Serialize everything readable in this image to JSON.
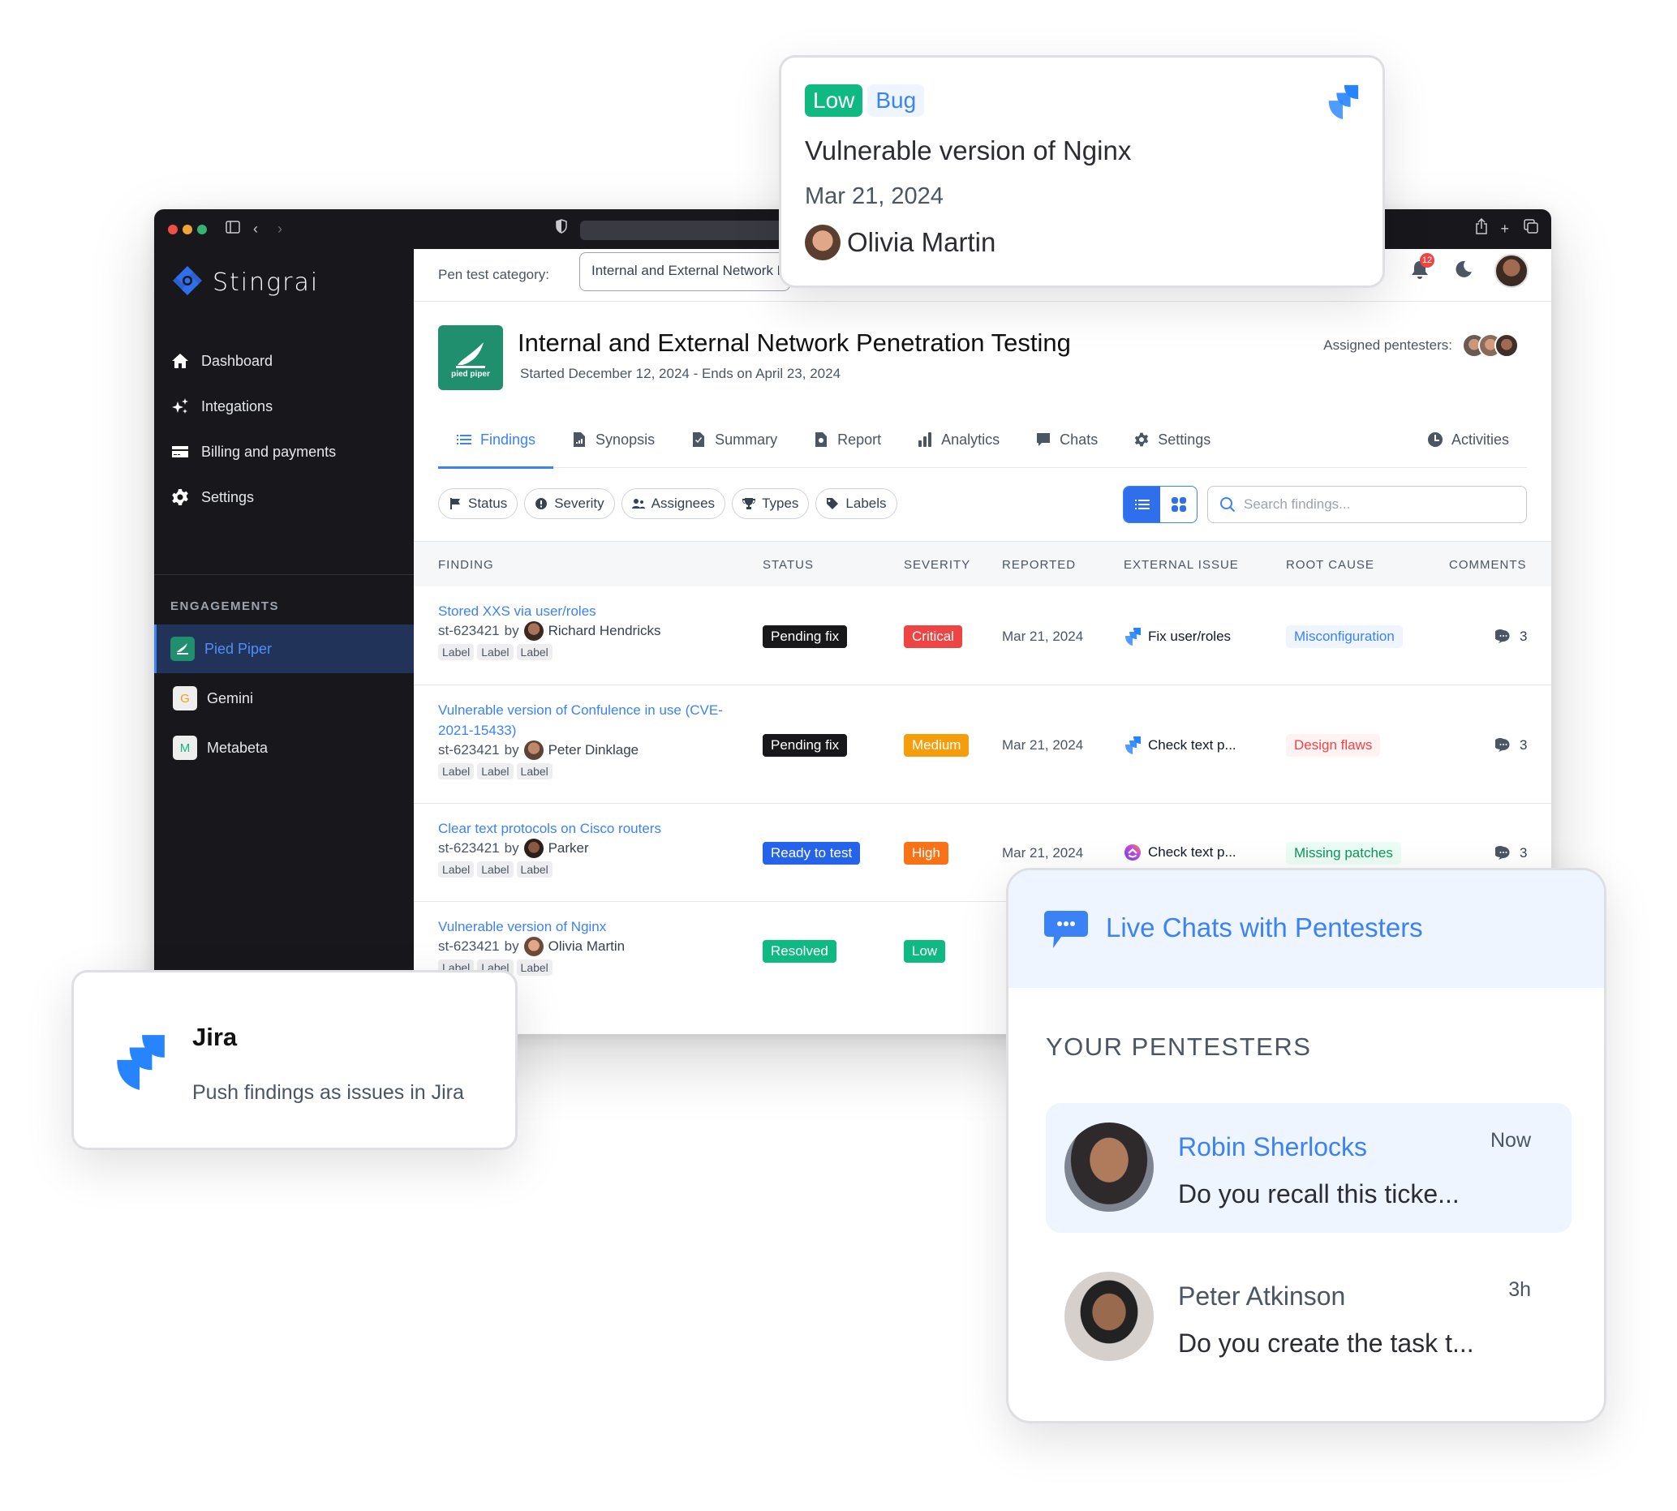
{
  "browser": {
    "controls": [
      "close",
      "minimize",
      "maximize"
    ],
    "toolbar_icons_left": [
      "sidebar-toggle-icon",
      "back-icon",
      "forward-icon"
    ],
    "toolbar_icons_right": [
      "share-icon",
      "new-tab-icon",
      "tabs-overview-icon"
    ]
  },
  "sidebar": {
    "brand": "Stingrai",
    "nav": [
      {
        "label": "Dashboard",
        "icon": "home-icon"
      },
      {
        "label": "Integations",
        "icon": "sparkles-icon"
      },
      {
        "label": "Billing and payments",
        "icon": "credit-card-icon"
      },
      {
        "label": "Settings",
        "icon": "gear-icon"
      }
    ],
    "section_label": "ENGAGEMENTS",
    "engagements": [
      {
        "label": "Pied Piper",
        "logo": "pied-piper",
        "active": true
      },
      {
        "label": "Gemini",
        "logo": "G",
        "active": false
      },
      {
        "label": "Metabeta",
        "logo": "M",
        "active": false
      }
    ]
  },
  "topbar": {
    "category_label": "Pen test category:",
    "category_value": "Internal and External Network Penetration Testing",
    "notifications_count": "12"
  },
  "project": {
    "logo_text": "pied piper",
    "title": "Internal and External Network Penetration Testing",
    "dates": "Started December 12, 2024 - Ends on April 23, 2024",
    "assigned_label": "Assigned pentesters:"
  },
  "tabs": [
    {
      "label": "Findings",
      "icon": "list-icon",
      "active": true
    },
    {
      "label": "Synopsis",
      "icon": "chart-file-icon"
    },
    {
      "label": "Summary",
      "icon": "check-file-icon"
    },
    {
      "label": "Report",
      "icon": "search-file-icon"
    },
    {
      "label": "Analytics",
      "icon": "bar-chart-icon"
    },
    {
      "label": "Chats",
      "icon": "chat-icon"
    },
    {
      "label": "Settings",
      "icon": "gear-icon"
    },
    {
      "label": "Activities",
      "icon": "clock-icon"
    }
  ],
  "filters": [
    {
      "label": "Status",
      "icon": "flag-icon"
    },
    {
      "label": "Severity",
      "icon": "exclamation-icon"
    },
    {
      "label": "Assignees",
      "icon": "users-icon"
    },
    {
      "label": "Types",
      "icon": "trophy-icon"
    },
    {
      "label": "Labels",
      "icon": "tag-icon"
    }
  ],
  "search": {
    "placeholder": "Search findings..."
  },
  "table": {
    "columns": [
      "FINDING",
      "STATUS",
      "SEVERITY",
      "REPORTED",
      "EXTERNAL ISSUE",
      "ROOT CAUSE",
      "COMMENTS"
    ],
    "rows": [
      {
        "title": "Stored XXS via user/roles",
        "id": "st-623421",
        "by": "by",
        "reporter": "Richard Hendricks",
        "labels": [
          "Label",
          "Label",
          "Label"
        ],
        "status": "Pending fix",
        "status_color": "#18181b",
        "severity": "Critical",
        "severity_color": "#ef4444",
        "reported": "Mar 21, 2024",
        "external_issue": "Fix user/roles",
        "external_icon": "jira",
        "root_cause": "Misconfiguration",
        "rc_bg": "#eef5ff",
        "rc_fg": "#3b82f6",
        "comments": "3"
      },
      {
        "title": "Vulnerable version of Confulence in use (CVE-2021-15433)",
        "id": "st-623421",
        "by": "by",
        "reporter": "Peter Dinklage",
        "labels": [
          "Label",
          "Label",
          "Label"
        ],
        "status": "Pending fix",
        "status_color": "#18181b",
        "severity": "Medium",
        "severity_color": "#f59e0b",
        "reported": "Mar 21, 2024",
        "external_issue": "Check text p...",
        "external_icon": "jira",
        "root_cause": "Design flaws",
        "rc_bg": "#fef2f2",
        "rc_fg": "#ef4444",
        "comments": "3"
      },
      {
        "title": "Clear text protocols on Cisco routers",
        "id": "st-623421",
        "by": "by",
        "reporter": "Parker",
        "labels": [
          "Label",
          "Label",
          "Label"
        ],
        "status": "Ready to test",
        "status_color": "#2563eb",
        "severity": "High",
        "severity_color": "#f97316",
        "reported": "Mar 21, 2024",
        "external_issue": "Check text p...",
        "external_icon": "clickup",
        "root_cause": "Missing patches",
        "rc_bg": "#ecfdf5",
        "rc_fg": "#10935f",
        "comments": "3"
      },
      {
        "title": "Vulnerable version of Nginx",
        "id": "st-623421",
        "by": "by",
        "reporter": "Olivia Martin",
        "labels": [
          "Label",
          "Label",
          "Label"
        ],
        "status": "Resolved",
        "status_color": "#10b981",
        "severity": "Low",
        "severity_color": "#10b981"
      }
    ]
  },
  "issue_card": {
    "severity": "Low",
    "type": "Bug",
    "title": "Vulnerable version of Nginx",
    "date": "Mar 21, 2024",
    "user": "Olivia Martin"
  },
  "jira_card": {
    "title": "Jira",
    "description": "Push findings as issues in Jira"
  },
  "chat_card": {
    "title": "Live Chats with Pentesters",
    "section": "YOUR PENTESTERS",
    "chats": [
      {
        "name": "Robin Sherlocks",
        "message": "Do you recall this ticke...",
        "time": "Now",
        "selected": true
      },
      {
        "name": "Peter Atkinson",
        "message": "Do you create the task t...",
        "time": "3h",
        "selected": false
      }
    ]
  },
  "colors": {
    "accent": "#3b82f6",
    "sidebar_bg": "#18181c",
    "sidebar_active": "#22335a",
    "jira_blue": "#2684ff",
    "pied_piper_green": "#1f8f6e"
  }
}
